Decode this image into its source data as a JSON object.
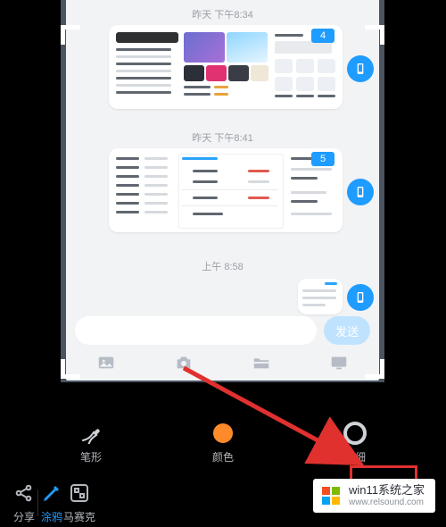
{
  "chat": {
    "ts1": "昨天 下午8:34",
    "ts2": "昨天 下午8:41",
    "ts3": "上午 8:58",
    "badge1": "4",
    "badge2": "5",
    "send_label": "发送"
  },
  "toolbar": {
    "pen_shape": "笔形",
    "color": "颜色",
    "thickness": "粗细",
    "share": "分享",
    "doodle": "涂鸦",
    "mosaic": "马赛克"
  },
  "colors": {
    "accent": "#1e9cff",
    "doodle_active": "#1e9cff",
    "brush_color": "#ff8a2a",
    "highlight": "#e0312e"
  },
  "watermark": {
    "title": "win11系统之家",
    "url": "www.relsound.com"
  }
}
